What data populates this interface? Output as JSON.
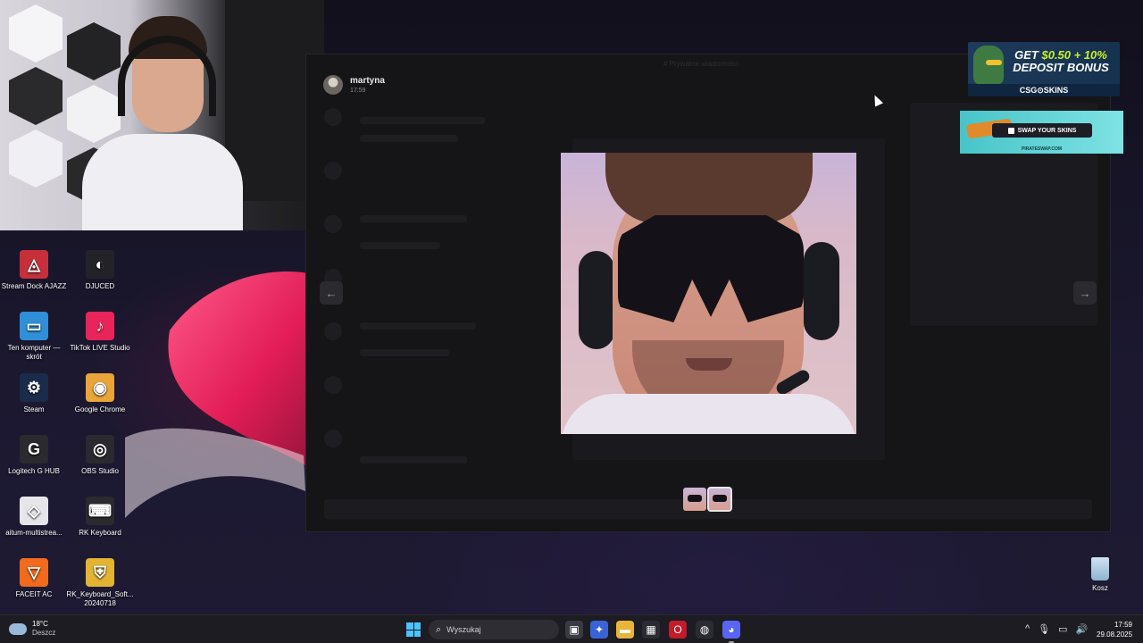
{
  "discord_viewer": {
    "username": "martyna",
    "time": "17:59",
    "prev_icon": "←",
    "next_icon": "→",
    "header_ghost": "# Prywatne wiadomości"
  },
  "desktop": {
    "icons": [
      {
        "label": "Stream Dock AJAZZ",
        "glyph": "◬",
        "color": "#c7303b"
      },
      {
        "label": "DJUCED",
        "glyph": "◐",
        "color": "#222228"
      },
      {
        "label": "Ten komputer — skrót",
        "glyph": "▭",
        "color": "#2f8fd8"
      },
      {
        "label": "TikTok LIVE Studio",
        "glyph": "♪",
        "color": "#e8245a"
      },
      {
        "label": "Steam",
        "glyph": "⚙",
        "color": "#1b2c4a"
      },
      {
        "label": "Google Chrome",
        "glyph": "◉",
        "color": "#e9a53b"
      },
      {
        "label": "Logitech G HUB",
        "glyph": "G",
        "color": "#2a2a2f"
      },
      {
        "label": "OBS Studio",
        "glyph": "◎",
        "color": "#2a2a2f"
      },
      {
        "label": "aitum-multistrea...",
        "glyph": "◇",
        "color": "#e6e6ea"
      },
      {
        "label": "RK Keyboard",
        "glyph": "⌨",
        "color": "#2a2a2f"
      },
      {
        "label": "FACEIT AC",
        "glyph": "▽",
        "color": "#f26a1b"
      },
      {
        "label": "RK_Keyboard_Soft... 20240718",
        "glyph": "⛨",
        "color": "#e3b334"
      }
    ],
    "recycle_bin": "Kosz"
  },
  "ads": {
    "ad1_line1": "GET ",
    "ad1_amount": "$0.50 + 10%",
    "ad1_line2": "DEPOSIT BONUS",
    "ad1_brand": "CSG⊙SKINS",
    "ad2_button": "SWAP YOUR SKINS",
    "ad2_site": "PIRATESWAP.COM"
  },
  "taskbar": {
    "weather_temp": "18°C",
    "weather_cond": "Deszcz",
    "search_placeholder": "Wyszukaj",
    "clock_time": "17:59",
    "clock_date": "29.08.2025",
    "apps": [
      {
        "name": "task-view",
        "glyph": "▣",
        "color": "#3a3a42"
      },
      {
        "name": "copilot",
        "glyph": "✦",
        "color": "#3a63d6"
      },
      {
        "name": "file-explorer",
        "glyph": "▬",
        "color": "#e8b43a"
      },
      {
        "name": "store",
        "glyph": "▦",
        "color": "#2b2b33"
      },
      {
        "name": "opera",
        "glyph": "O",
        "color": "#c21b2a"
      },
      {
        "name": "steelseries",
        "glyph": "◍",
        "color": "#2b2b33"
      },
      {
        "name": "discord",
        "glyph": "◕",
        "color": "#5865f2"
      }
    ],
    "tray_icons": [
      "^",
      "🎙",
      "▭",
      "🔊"
    ]
  },
  "colors": {
    "discord_accent": "#5865f2",
    "windows_accent": "#4cc2ff"
  }
}
